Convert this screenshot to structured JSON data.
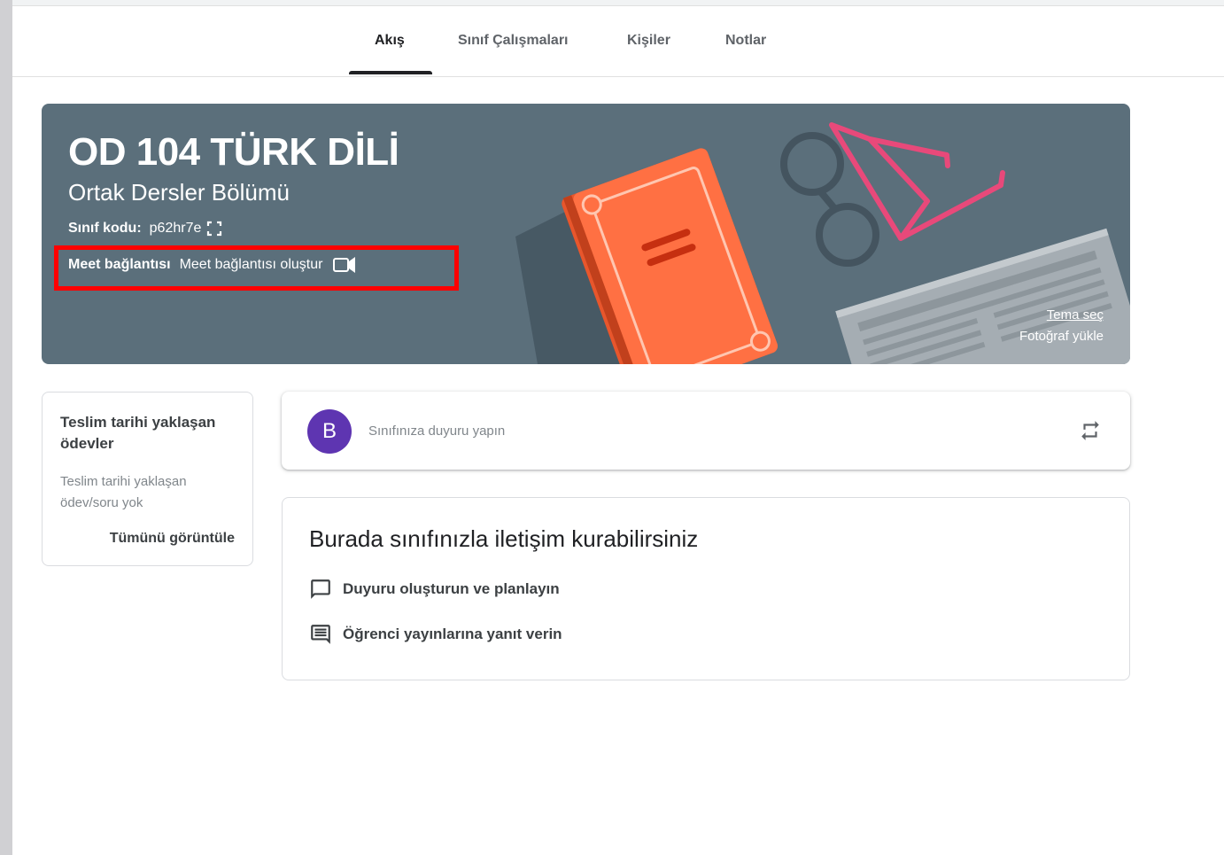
{
  "tabs": [
    {
      "label": "Akış",
      "active": true
    },
    {
      "label": "Sınıf Çalışmaları"
    },
    {
      "label": "Kişiler"
    },
    {
      "label": "Notlar"
    }
  ],
  "banner": {
    "title": "OD 104 TÜRK DİLİ",
    "subtitle": "Ortak Dersler Bölümü",
    "class_code_label": "Sınıf kodu:",
    "class_code": "p62hr7e",
    "meet_label": "Meet bağlantısı",
    "meet_link": "Meet bağlantısı oluştur",
    "theme_link": "Tema seç",
    "upload_link": "Fotoğraf yükle",
    "background_color": "#5b6f7b",
    "highlight_color": "#ff0000"
  },
  "upcoming": {
    "title": "Teslim tarihi yaklaşan ödevler",
    "empty_text": "Teslim tarihi yaklaşan ödev/soru yok",
    "view_all": "Tümünü görüntüle"
  },
  "announce": {
    "avatar_letter": "B",
    "avatar_color": "#5e35b1",
    "placeholder": "Sınıfınıza duyuru yapın"
  },
  "info": {
    "heading": "Burada sınıfınızla iletişim kurabilirsiniz",
    "items": [
      {
        "icon": "announcement-icon",
        "label": "Duyuru oluşturun ve planlayın"
      },
      {
        "icon": "comment-icon",
        "label": "Öğrenci yayınlarına yanıt verin"
      }
    ]
  }
}
